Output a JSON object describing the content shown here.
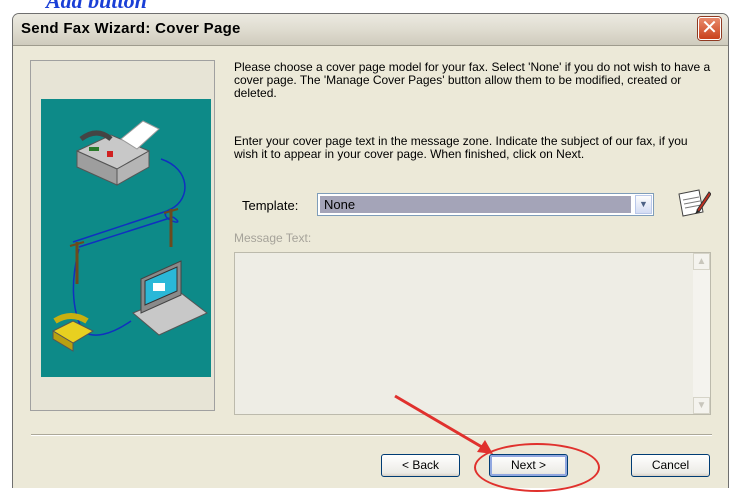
{
  "caption": "Add button",
  "window": {
    "title": "Send Fax Wizard: Cover Page"
  },
  "instructions": {
    "paragraph1": "Please choose a cover page model for your fax. Select 'None' if you do not wish to have a cover page. The 'Manage Cover Pages' button allow them to be modified, created or deleted.",
    "paragraph2": "Enter your cover page text in the message zone. Indicate the subject of our fax, if you wish it to appear in your cover page. When finished, click on Next."
  },
  "template": {
    "label": "Template:",
    "selected": "None"
  },
  "message": {
    "label": "Message Text:",
    "value": ""
  },
  "buttons": {
    "back": "< Back",
    "next": "Next >",
    "cancel": "Cancel"
  },
  "colors": {
    "highlight": "#e0312d",
    "art_background": "#0d8a88"
  }
}
